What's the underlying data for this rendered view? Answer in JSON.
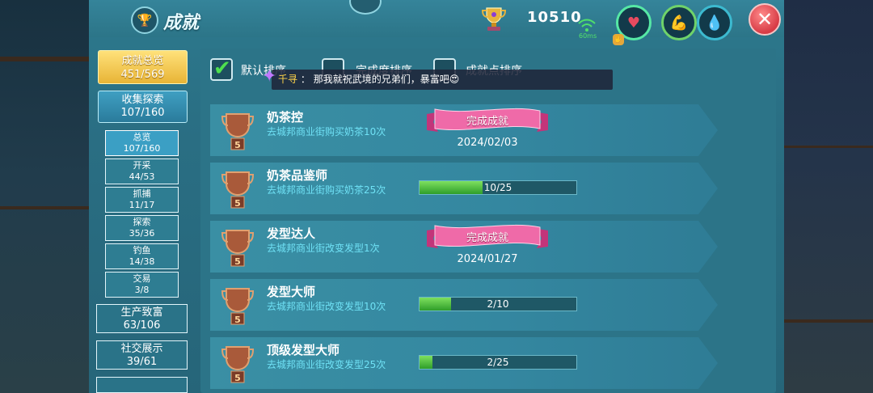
{
  "header": {
    "title": "成就",
    "score": "10510",
    "ping": "60ms",
    "status_rings": [
      {
        "name": "heart-icon",
        "glyph": "♥",
        "color": "#e84a5f"
      },
      {
        "name": "arm-icon",
        "glyph": "💪",
        "color": "#f3c84a"
      },
      {
        "name": "drop-icon",
        "glyph": "💧",
        "color": "#3cc6d8"
      }
    ],
    "close_label": "✕"
  },
  "sidebar": {
    "main": {
      "label": "成就总览",
      "value": "451/569"
    },
    "collect": {
      "label": "收集探索",
      "value": "107/160"
    },
    "subs": [
      {
        "label": "总览",
        "value": "107/160",
        "active": true
      },
      {
        "label": "开采",
        "value": "44/53"
      },
      {
        "label": "抓捕",
        "value": "11/17"
      },
      {
        "label": "探索",
        "value": "35/36"
      },
      {
        "label": "钓鱼",
        "value": "14/38"
      },
      {
        "label": "交易",
        "value": "3/8"
      }
    ],
    "categories": [
      {
        "label": "生产致富",
        "value": "63/106"
      },
      {
        "label": "社交展示",
        "value": "39/61"
      }
    ]
  },
  "sort": {
    "options": [
      {
        "label": "默认排序",
        "checked": true
      },
      {
        "label": "完成度排序",
        "checked": false
      },
      {
        "label": "成就点排序",
        "checked": false
      }
    ]
  },
  "chat": {
    "name": "千寻",
    "message": "那我就祝武境的兄弟们，暴富吧😍"
  },
  "achievements": [
    {
      "name": "奶茶控",
      "desc": "去城邦商业街购买奶茶10次",
      "medal_level": "5",
      "completed": true,
      "status": "完成成就",
      "date": "2024/02/03"
    },
    {
      "name": "奶茶品鉴师",
      "desc": "去城邦商业街购买奶茶25次",
      "medal_level": "5",
      "completed": false,
      "progress_text": "10/25",
      "progress": 0.4
    },
    {
      "name": "发型达人",
      "desc": "去城邦商业街改变发型1次",
      "medal_level": "5",
      "completed": true,
      "status": "完成成就",
      "date": "2024/01/27"
    },
    {
      "name": "发型大师",
      "desc": "去城邦商业街改变发型10次",
      "medal_level": "5",
      "completed": false,
      "progress_text": "2/10",
      "progress": 0.2
    },
    {
      "name": "顶级发型大师",
      "desc": "去城邦商业街改变发型25次",
      "medal_level": "5",
      "completed": false,
      "progress_text": "2/25",
      "progress": 0.08
    }
  ]
}
